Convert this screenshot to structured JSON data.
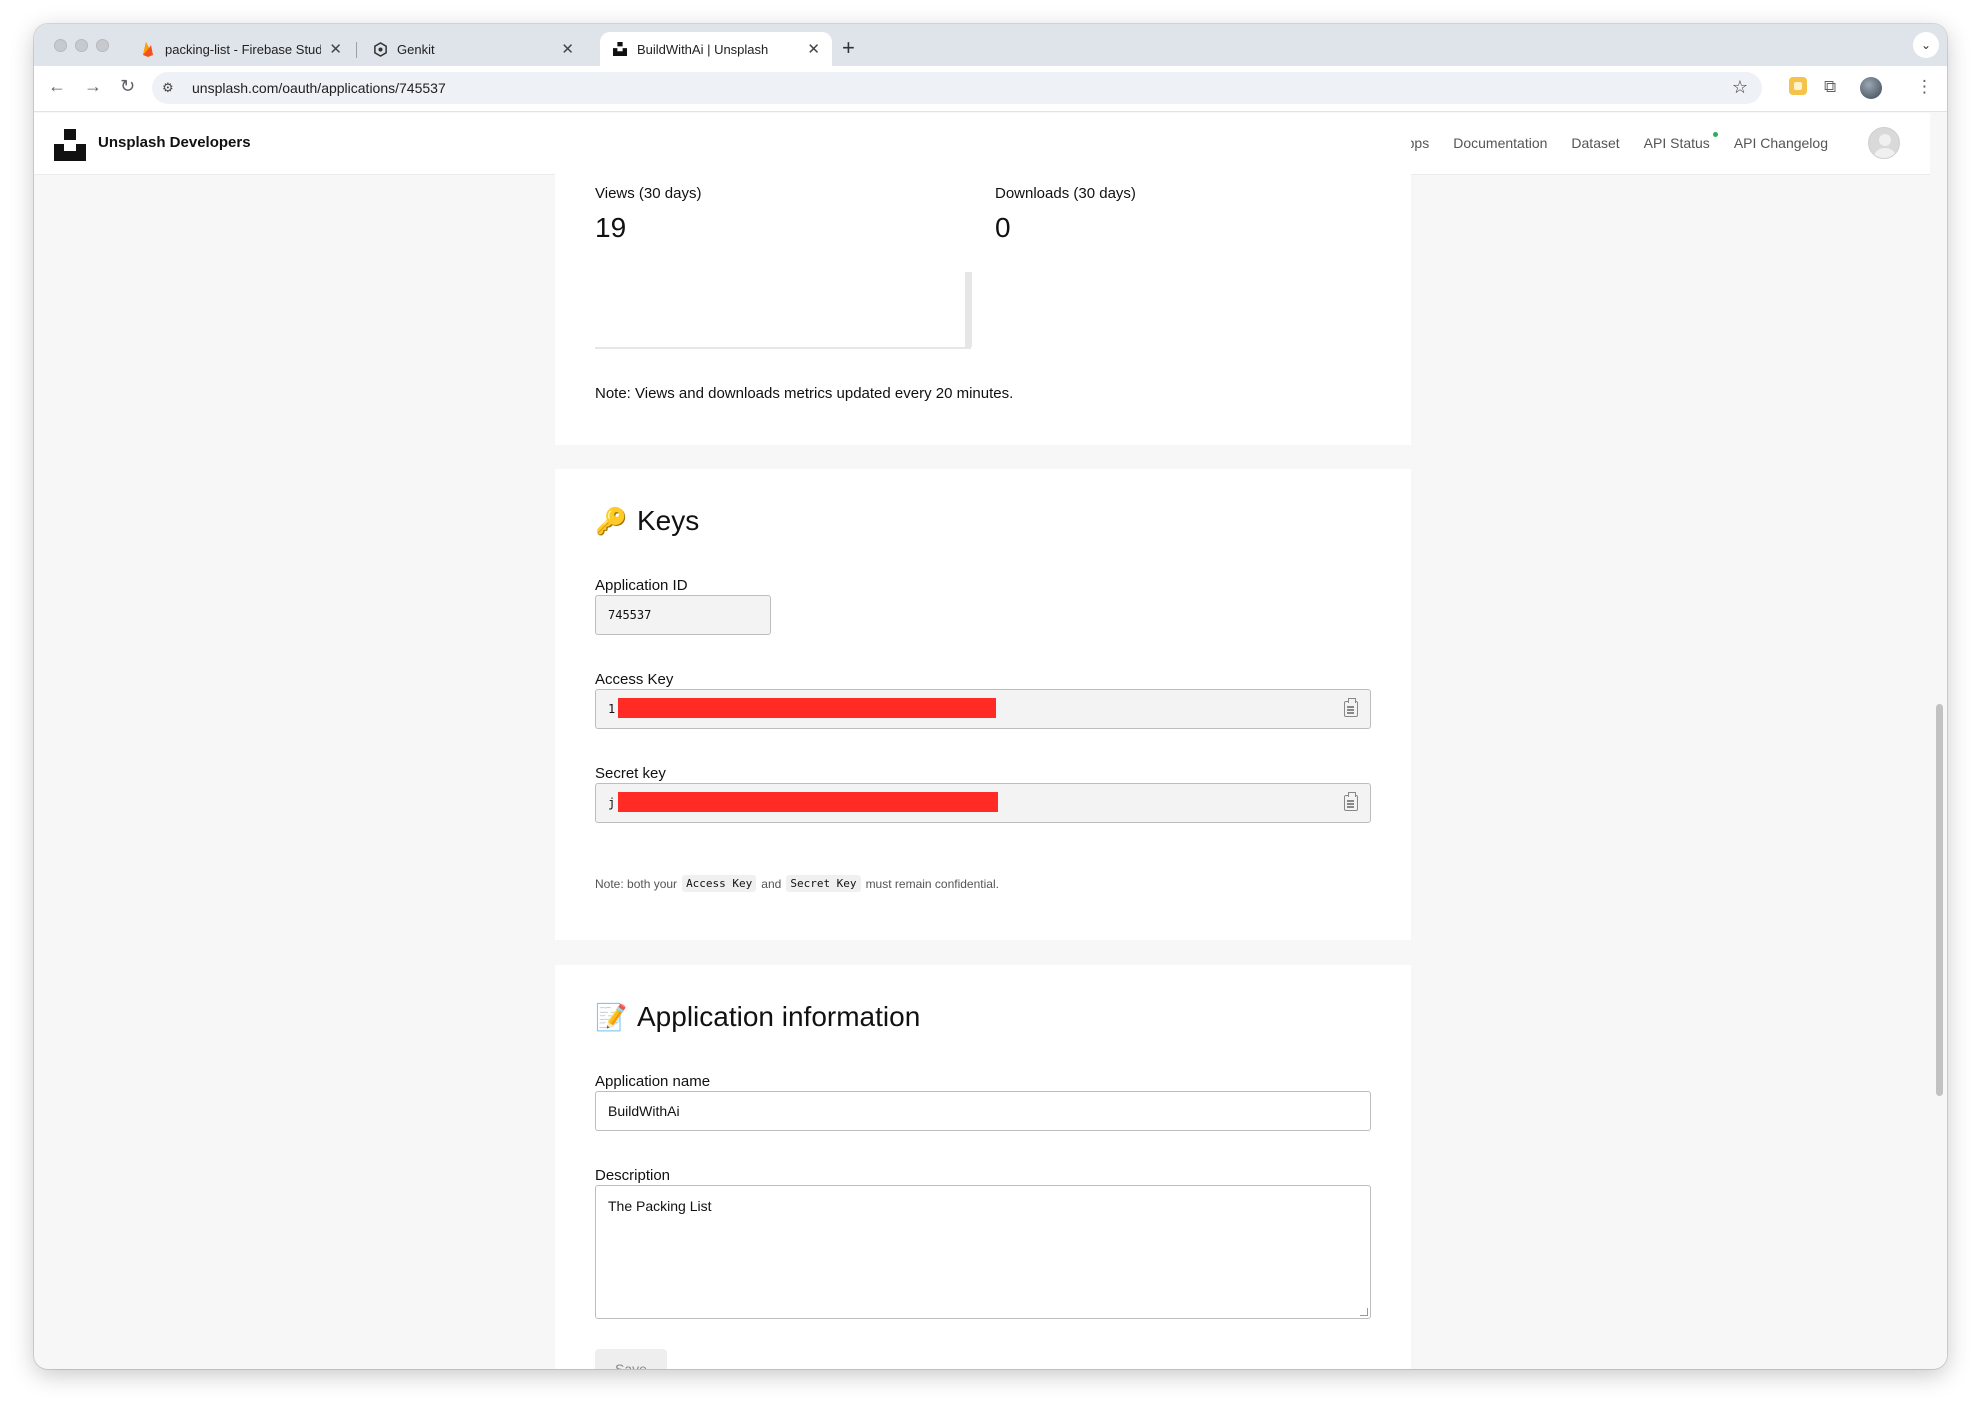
{
  "browser": {
    "tabs": [
      {
        "label": "packing-list - Firebase Studio",
        "icon": "firebase-icon"
      },
      {
        "label": "Genkit",
        "icon": "genkit-icon"
      },
      {
        "label": "BuildWithAi | Unsplash",
        "icon": "unsplash-icon"
      }
    ],
    "url": "unsplash.com/oauth/applications/745537"
  },
  "header": {
    "brand": "Unsplash Developers",
    "nav": [
      "Your apps",
      "Documentation",
      "Dataset",
      "API Status",
      "API Changelog"
    ],
    "api_status_color": "#2ab05c"
  },
  "stats": {
    "views_label": "Views (30 days)",
    "views_value": "19",
    "downloads_label": "Downloads (30 days)",
    "downloads_value": "0",
    "note": "Note: Views and downloads metrics updated every 20 minutes."
  },
  "keys": {
    "title": "Keys",
    "emoji": "🔑",
    "app_id_label": "Application ID",
    "app_id_value": "745537",
    "access_key_label": "Access Key",
    "access_key_prefix": "1",
    "secret_key_label": "Secret key",
    "secret_key_prefix": "j",
    "note_start": "Note: both your",
    "note_code1": "Access Key",
    "note_and": "and",
    "note_code2": "Secret Key",
    "note_end": "must remain confidential.",
    "redaction_color": "#ff2b24"
  },
  "app_info": {
    "title": "Application information",
    "emoji": "📝",
    "name_label": "Application name",
    "name_value": "BuildWithAi",
    "description_label": "Description",
    "description_value": "The Packing List",
    "save_label": "Save"
  }
}
